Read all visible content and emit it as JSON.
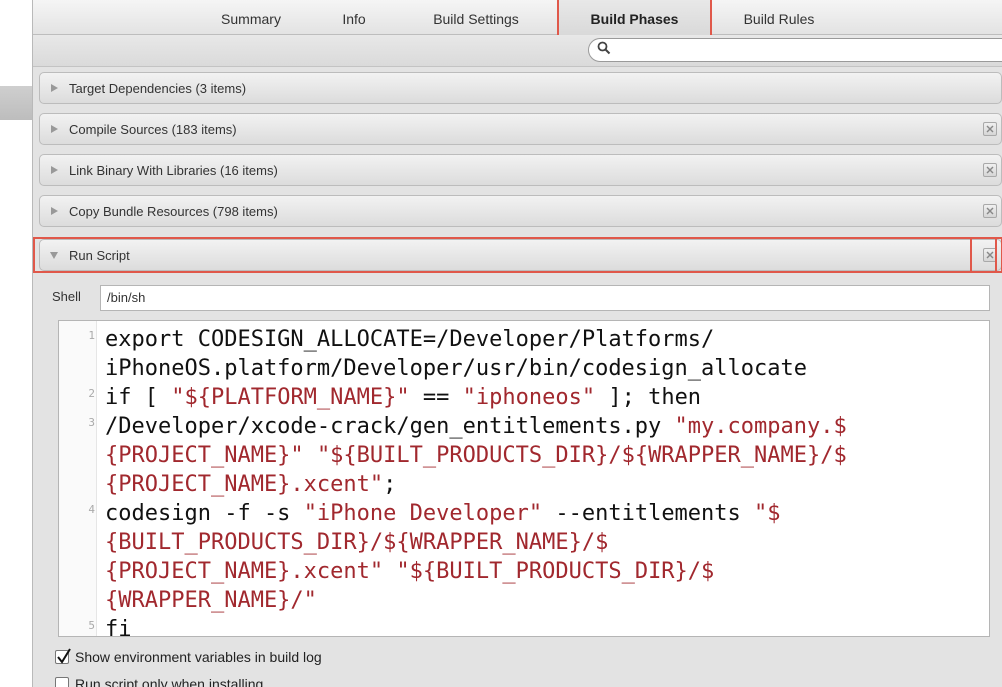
{
  "tabs": [
    {
      "label": "Summary",
      "active": false
    },
    {
      "label": "Info",
      "active": false
    },
    {
      "label": "Build Settings",
      "active": false
    },
    {
      "label": "Build Phases",
      "active": true
    },
    {
      "label": "Build Rules",
      "active": false
    }
  ],
  "search": {
    "placeholder": "",
    "icon": "magnifier-icon"
  },
  "phases": [
    {
      "label": "Target Dependencies (3 items)",
      "expanded": false,
      "has_delete": false
    },
    {
      "label": "Compile Sources (183 items)",
      "expanded": false,
      "has_delete": true
    },
    {
      "label": "Link Binary With Libraries (16 items)",
      "expanded": false,
      "has_delete": true
    },
    {
      "label": "Copy Bundle Resources (798 items)",
      "expanded": false,
      "has_delete": true
    },
    {
      "label": "Run Script",
      "expanded": true,
      "has_delete": true
    }
  ],
  "run_script": {
    "shell_label": "Shell",
    "shell_value": "/bin/sh",
    "line_numbers": [
      "1",
      "2",
      "3",
      "4",
      "5"
    ],
    "script": [
      "export CODESIGN_ALLOCATE=/Developer/Platforms/",
      "iPhoneOS.platform/Developer/usr/bin/codesign_allocate",
      "if [ \"${PLATFORM_NAME}\" == \"iphoneos\" ]; then",
      "/Developer/xcode-crack/gen_entitlements.py \"my.company.$",
      "{PROJECT_NAME}\" \"${BUILT_PRODUCTS_DIR}/${WRAPPER_NAME}/$",
      "{PROJECT_NAME}.xcent\";",
      "codesign -f -s \"iPhone Developer\" --entitlements \"$",
      "{BUILT_PRODUCTS_DIR}/${WRAPPER_NAME}/$",
      "{PROJECT_NAME}.xcent\" \"${BUILT_PRODUCTS_DIR}/$",
      "{WRAPPER_NAME}/\"",
      "fi"
    ],
    "options": [
      {
        "label": "Show environment variables in build log",
        "checked": true
      },
      {
        "label": "Run script only when installing",
        "checked": false
      }
    ]
  },
  "colors": {
    "highlight": "#e0584a",
    "string": "#a1282e"
  }
}
